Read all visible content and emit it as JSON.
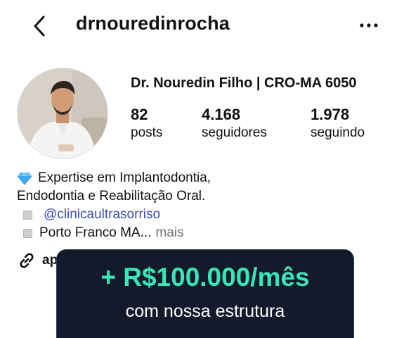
{
  "header": {
    "username": "drnouredinrocha",
    "back_icon": "chevron-left-icon",
    "more_icon": "more-horizontal-icon"
  },
  "profile": {
    "display_name": "Dr. Nouredin Filho | CRO-MA 6050",
    "stats": [
      {
        "value": "82",
        "label": "posts"
      },
      {
        "value": "4.168",
        "label": "seguidores"
      },
      {
        "value": "1.978",
        "label": "seguindo"
      }
    ]
  },
  "bio": {
    "line1": "Expertise em Implantodontia,",
    "line1_icon": "gem-icon",
    "line2": "Endodontia e Reabilitação Oral.",
    "mention": "@clinicaultrasorriso",
    "location": "Porto Franco MA...",
    "more_label": "mais"
  },
  "external_link": {
    "icon": "link-icon",
    "text": "ap"
  },
  "overlay": {
    "title": "+ R$100.000/mês",
    "subtitle": "com nossa estrutura"
  },
  "colors": {
    "link": "#3a4cb8",
    "banner_bg": "#141a2b",
    "banner_accent": "#39e6b5"
  }
}
